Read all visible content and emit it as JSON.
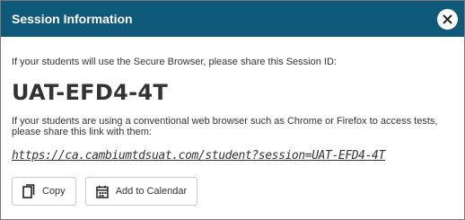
{
  "dialog": {
    "title": "Session Information",
    "close_icon": "close-icon"
  },
  "content": {
    "secure_browser_text": "If your students will use the Secure Browser, please share this Session ID:",
    "session_id": "UAT-EFD4-4T",
    "web_browser_text": "If your students are using a conventional web browser such as Chrome or Firefox to access tests, please share this link with them:",
    "session_link": "https://ca.cambiumtdsuat.com/student?session=UAT-EFD4-4T"
  },
  "actions": {
    "copy_label": "Copy",
    "copy_icon": "copy-icon",
    "calendar_label": "Add to Calendar",
    "calendar_icon": "calendar-icon"
  },
  "colors": {
    "header_bg": "#0f5a7a",
    "header_text": "#ffffff",
    "body_text": "#333333"
  }
}
